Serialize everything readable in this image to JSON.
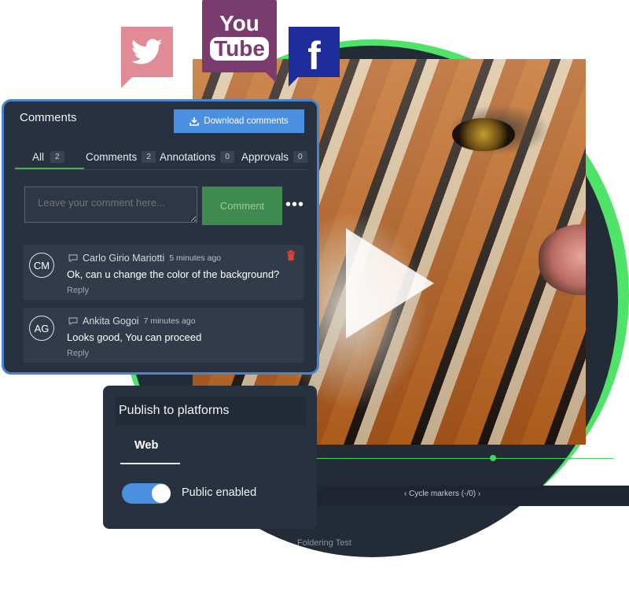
{
  "social": {
    "youtube_top": "You",
    "youtube_bottom": "Tube",
    "facebook_letter": "f",
    "twitter_icon": "bird-icon"
  },
  "video": {
    "cycle_markers": "Cycle markers  (-/0)",
    "folder_label": "Foldering Test"
  },
  "comments": {
    "title": "Comments",
    "download_label": "Download comments",
    "tabs": [
      {
        "label": "All",
        "count": "2"
      },
      {
        "label": "Comments",
        "count": "2"
      },
      {
        "label": "Annotations",
        "count": "0"
      },
      {
        "label": "Approvals",
        "count": "0"
      }
    ],
    "input_placeholder": "Leave your comment here...",
    "submit_label": "Comment",
    "more_label": "•••",
    "items": [
      {
        "initials": "CM",
        "author": "Carlo Girio Mariotti",
        "time": "5 minutes ago",
        "text": "Ok, can u change the color of the background?",
        "reply": "Reply"
      },
      {
        "initials": "AG",
        "author": "Ankita Gogoi",
        "time": "7 minutes ago",
        "text": "Looks good, You can proceed",
        "reply": "Reply"
      }
    ]
  },
  "publish": {
    "title": "Publish to platforms",
    "tab": "Web",
    "toggle_label": "Public enabled",
    "toggle_on": true
  },
  "colors": {
    "accent_green": "#4fe36a",
    "panel_bg": "#283140",
    "primary_blue": "#4a90e2",
    "comment_green": "#3f8a4f"
  }
}
